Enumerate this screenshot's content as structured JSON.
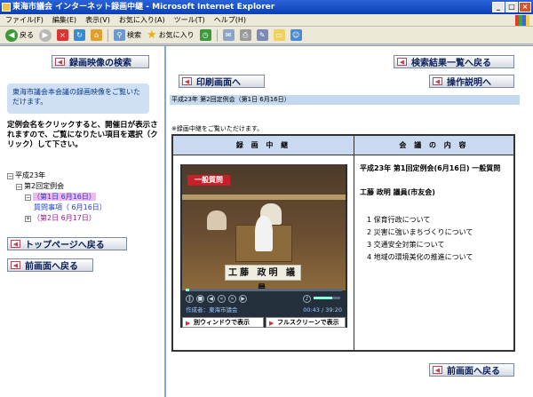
{
  "window": {
    "title": "東海市議会 インターネット録画中継 - Microsoft Internet Explorer"
  },
  "menu": [
    "ファイル(F)",
    "編集(E)",
    "表示(V)",
    "お気に入り(A)",
    "ツール(T)",
    "ヘルプ(H)"
  ],
  "toolbar": {
    "back": "戻る",
    "search": "検索",
    "favorites": "お気に入り"
  },
  "left": {
    "search_button": "録画映像の検索",
    "info": "東海市議会本会議の録画映像をご覧いただけます。",
    "instructions": "定例会名をクリックすると、開催日が表示されますので、ご覧になりたい項目を選択（クリック）して下さい。",
    "tree": {
      "year": "平成23年",
      "session": "第2回定例会",
      "day1": "（第1日 6月16日）",
      "question": "質問事項（ 6月16日）",
      "day2": "（第2日 6月17日）"
    },
    "top_button": "トップページへ戻る",
    "back_button": "前画面へ戻る"
  },
  "right": {
    "results_button": "検索結果一覧へ戻る",
    "print_button": "印刷画面へ",
    "manual_button": "操作説明へ",
    "session_bar": "平成23年 第2回定例会（第1日 6月16日）",
    "note": "※録画中継をご覧いただけます。",
    "col_recording": "録 画 中 継",
    "col_content": "会 議 の 内 容",
    "player": {
      "caption": "一般質問",
      "nameplate": "工藤 政明 議員",
      "author": "作成者：東海市議会",
      "time": "00:43 / 39:20",
      "progress": 0.02,
      "volume": 0.7,
      "separate_window": "別ウィンドウで表示",
      "fullscreen": "フルスクリーンで表示"
    },
    "meeting_title": "平成23年 第1回定例会(6月16日) 一般質問",
    "speaker": "工藤 政明 議員(市友会)",
    "items": [
      "1  保育行政について",
      "2  災害に強いまちづくりについて",
      "3  交通安全対策について",
      "4  地域の環境美化の推進について"
    ],
    "back_button": "前画面へ戻る"
  }
}
